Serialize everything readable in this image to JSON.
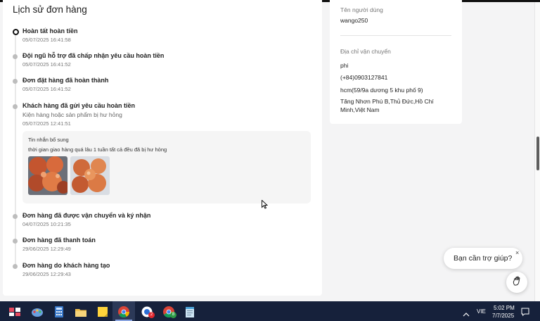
{
  "order_history": {
    "title": "Lịch sử đơn hàng",
    "events": [
      {
        "title": "Hoàn tất hoàn tiền",
        "date": "05/07/2025 16:41:58",
        "active": true
      },
      {
        "title": "Đội ngũ hỗ trợ đã chấp nhận yêu cầu hoàn tiền",
        "date": "05/07/2025 16:41:52"
      },
      {
        "title": "Đơn đặt hàng đã hoàn thành",
        "date": "05/07/2025 16:41:52"
      },
      {
        "title": "Khách hàng đã gửi yêu cầu hoàn tiền",
        "subtitle": "Kiện hàng hoặc sản phẩm bị hư hỏng",
        "date": "05/07/2025 12:41:51"
      },
      {
        "title": "Đơn hàng đã được vận chuyển và ký nhận",
        "date": "04/07/2025 10:21:35"
      },
      {
        "title": "Đơn hàng đã thanh toán",
        "date": "29/06/2025 12:29:49"
      },
      {
        "title": "Đơn hàng do khách hàng tạo",
        "date": "29/06/2025 12:29:43"
      }
    ],
    "note": {
      "title": "Tin nhắn bổ sung",
      "text": "thời gian giao hàng quá lâu 1 tuần tất cả đều đã bị hư hỏng",
      "images": [
        "damaged-fruit-photo-1",
        "damaged-fruit-photo-2"
      ]
    }
  },
  "customer": {
    "username_label": "Tên người dùng",
    "username": "wango250",
    "address_label": "Địa chỉ vận chuyển",
    "name": "phi",
    "phone": "(+84)0903127841",
    "address_line1": "hcm(59/9a dương 5 khu phố 9)",
    "address_line2": "Tăng Nhơn Phú B,Thủ Đức,Hồ Chí",
    "address_line3": "Minh,Việt Nam"
  },
  "help_widget": {
    "text": "Bạn cần trợ giúp?",
    "close": "×",
    "icon": "waving-hand-icon"
  },
  "taskbar": {
    "icons": [
      "app-icon",
      "paint-icon",
      "calculator-icon",
      "file-explorer-icon",
      "sticky-notes-icon",
      "chrome-icon",
      "chat-app-icon",
      "chrome-profile-icon",
      "notepad-icon"
    ],
    "chat_badge": "2",
    "chrome_badge": "8",
    "language": "VIE",
    "time": "5:02 PM",
    "date": "7/7/2025"
  },
  "colors": {
    "timeline_dot": "#bdbdbd",
    "active_dot_border": "#111111",
    "taskbar_bg": "#16213b"
  }
}
